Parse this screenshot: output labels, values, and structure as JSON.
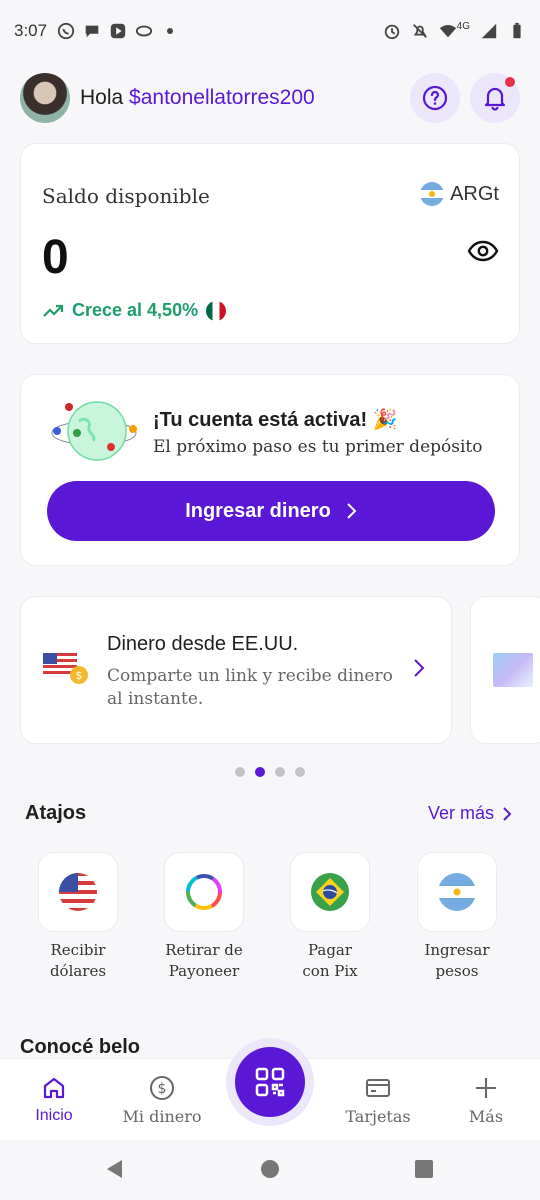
{
  "status_bar": {
    "time": "3:07",
    "network": "4G"
  },
  "header": {
    "greeting": "Hola",
    "username": "$antonellatorres200"
  },
  "balance": {
    "label": "Saldo disponible",
    "currency": "ARGt",
    "amount": "0",
    "growth_text": "Crece al 4,50%"
  },
  "activation": {
    "title": "¡Tu cuenta está activa! 🎉",
    "subtitle": "El próximo paso es tu primer depósito",
    "button_label": "Ingresar dinero"
  },
  "promo": {
    "title": "Dinero desde EE.UU.",
    "subtitle": "Comparte un link y recibe dinero al instante."
  },
  "carousel": {
    "count": 4,
    "active_index": 1
  },
  "shortcuts": {
    "title": "Atajos",
    "see_more": "Ver más",
    "items": [
      {
        "label_line1": "Recibir",
        "label_line2": "dólares",
        "icon": "us-flag-icon"
      },
      {
        "label_line1": "Retirar de",
        "label_line2": "Payoneer",
        "icon": "payoneer-icon"
      },
      {
        "label_line1": "Pagar",
        "label_line2": "con Pix",
        "icon": "brazil-flag-icon"
      },
      {
        "label_line1": "Ingresar",
        "label_line2": "pesos",
        "icon": "argentina-flag-icon"
      }
    ]
  },
  "know_section": {
    "title": "Conocé belo"
  },
  "bottom_nav": {
    "items": [
      {
        "label": "Inicio",
        "active": true
      },
      {
        "label": "Mi dinero",
        "active": false
      },
      {
        "label": "Tarjetas",
        "active": false
      },
      {
        "label": "Más",
        "active": false
      }
    ]
  },
  "colors": {
    "accent": "#5a17d6",
    "accent_light": "#ece6fb",
    "growth": "#1e9e6a",
    "notification": "#e6304a"
  }
}
